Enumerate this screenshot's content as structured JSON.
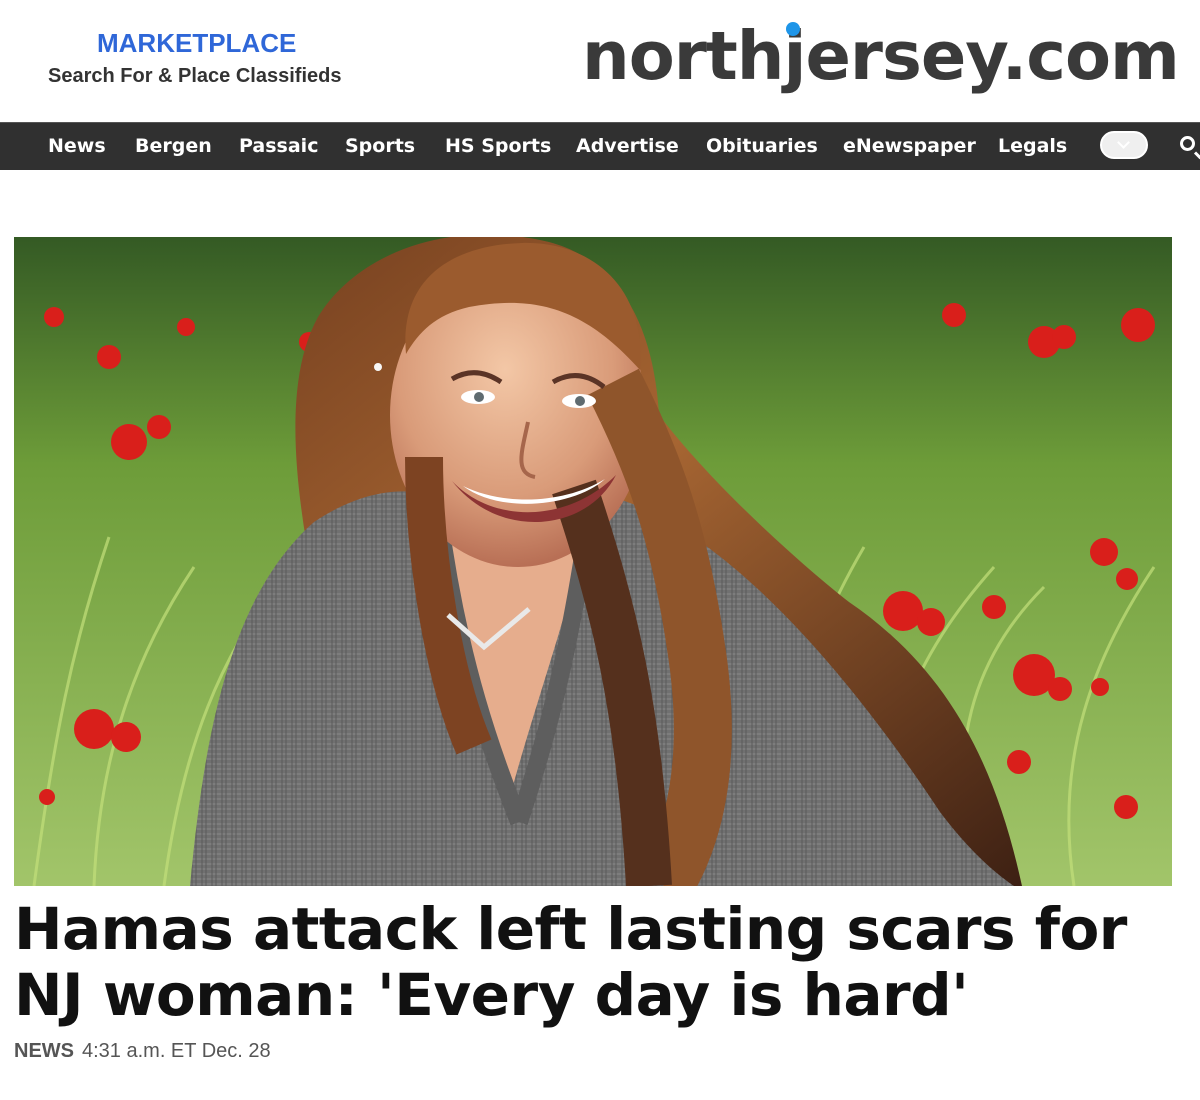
{
  "header": {
    "marketplace_title": "MARKETPLACE",
    "marketplace_subtitle": "Search For & Place Classifieds",
    "logo": "northjersey.com",
    "colors": {
      "marketplace": "#2f67d8",
      "logo": "#3a3a3a",
      "logo_dot": "#1e95e8"
    }
  },
  "navigation": {
    "items": [
      {
        "label": "News"
      },
      {
        "label": "Bergen"
      },
      {
        "label": "Passaic"
      },
      {
        "label": "Sports"
      },
      {
        "label": "HS Sports"
      },
      {
        "label": "Advertise"
      },
      {
        "label": "Obituaries"
      },
      {
        "label": "eNewspaper"
      },
      {
        "label": "Legals"
      }
    ],
    "more_icon": "chevron-down-icon",
    "search_icon": "search-icon",
    "background": "#303030"
  },
  "article": {
    "headline": "Hamas attack left lasting scars for NJ woman: 'Every day is hard'",
    "section": "NEWS",
    "timestamp": "4:31 a.m. ET Dec. 28"
  }
}
